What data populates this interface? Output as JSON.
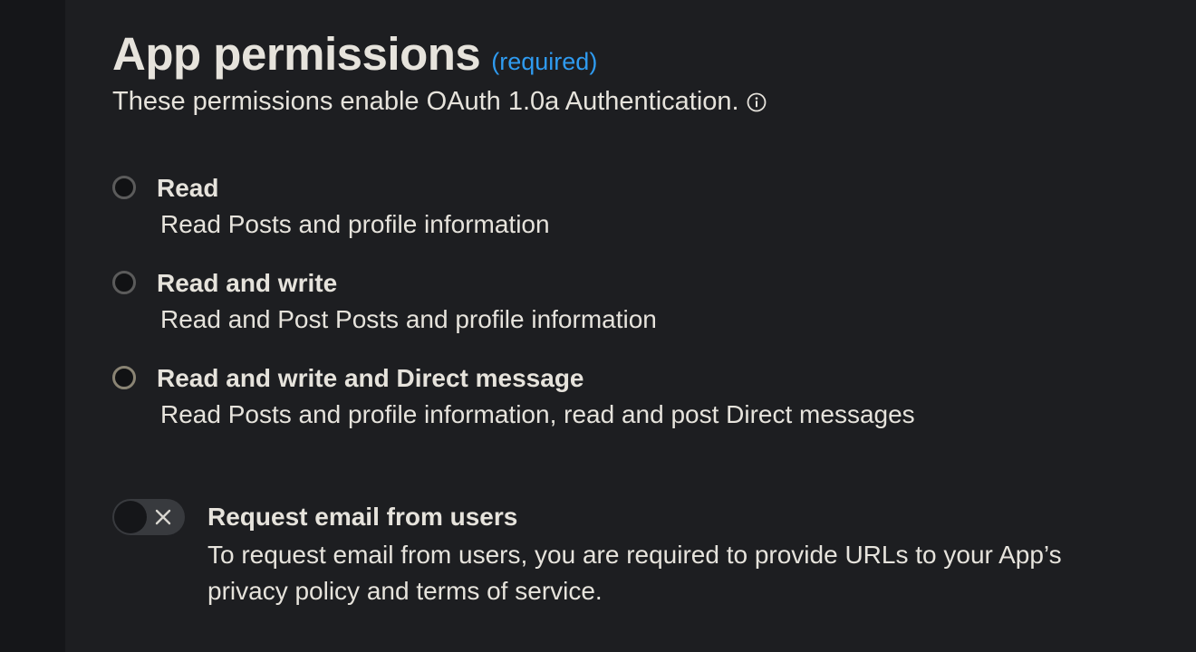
{
  "section": {
    "title": "App permissions",
    "required_label": "(required)",
    "subtitle": "These permissions enable OAuth 1.0a Authentication.",
    "info_icon": "info-icon"
  },
  "permissions": {
    "options": [
      {
        "label": "Read",
        "description": "Read Posts and profile information",
        "selected": false
      },
      {
        "label": "Read and write",
        "description": "Read and Post Posts and profile information",
        "selected": false
      },
      {
        "label": "Read and write and Direct message",
        "description": "Read Posts and profile information, read and post Direct messages",
        "selected": true
      }
    ]
  },
  "email_request": {
    "title": "Request email from users",
    "description": "To request email from users, you are required to provide URLs to your App’s privacy policy and terms of service.",
    "enabled": false,
    "toggle_icon": "close-icon"
  },
  "colors": {
    "background": "#1d1e21",
    "accent": "#2f9bf0",
    "text": "#e6e3dc",
    "toggle_off": "#383a3e"
  }
}
